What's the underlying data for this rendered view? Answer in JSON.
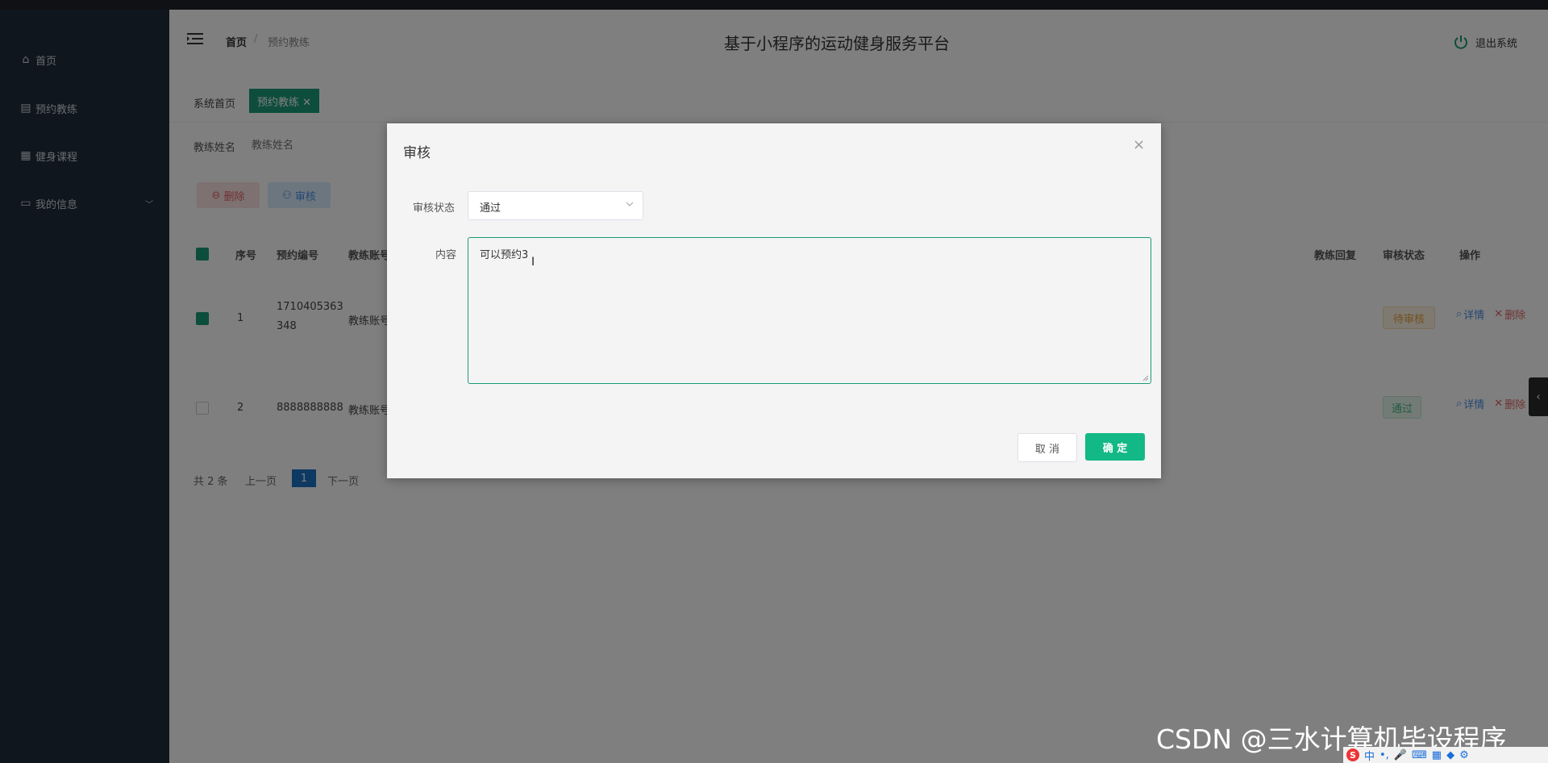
{
  "sidebar": {
    "items": [
      {
        "label": "首页",
        "icon": "home-icon"
      },
      {
        "label": "预约教练",
        "icon": "clipboard-icon"
      },
      {
        "label": "健身课程",
        "icon": "grid-icon"
      },
      {
        "label": "我的信息",
        "icon": "card-icon"
      }
    ]
  },
  "header": {
    "breadcrumb_home": "首页",
    "breadcrumb_sep": "/",
    "breadcrumb_current": "预约教练",
    "title": "基于小程序的运动健身服务平台",
    "logout": "退出系统"
  },
  "tags": {
    "home": "系统首页",
    "active": "预约教练 ✕"
  },
  "search": {
    "label": "教练姓名",
    "placeholder": "教练姓名"
  },
  "toolbar": {
    "delete": "删除",
    "audit": "审核"
  },
  "table": {
    "headers": [
      "序号",
      "预约编号",
      "教练账号",
      "教练回复",
      "审核状态",
      "操作"
    ],
    "rows": [
      {
        "index": "1",
        "id_line1": "1710405363",
        "id_line2": "348",
        "account": "教练账号",
        "status": "待审核",
        "view": "详情",
        "del": "删除"
      },
      {
        "index": "2",
        "id_line1": "8888888888",
        "id_line2": "",
        "account": "教练账号",
        "status": "通过",
        "view": "详情",
        "del": "删除"
      }
    ]
  },
  "pager": {
    "total": "共 2 条",
    "prev": "上一页",
    "current": "1",
    "next": "下一页"
  },
  "dialog": {
    "title": "审核",
    "close": "×",
    "status_label": "审核状态",
    "status_value": "通过",
    "content_label": "内容",
    "content_value": "可以预约3",
    "cancel": "取 消",
    "ok": "确 定"
  },
  "watermark": "CSDN @三水计算机毕设程序",
  "ime": {
    "logo": "S",
    "lang": "中"
  },
  "colors": {
    "sidebar": "#1f2d3d",
    "accent": "#1a9a77",
    "ok": "#12b886"
  }
}
